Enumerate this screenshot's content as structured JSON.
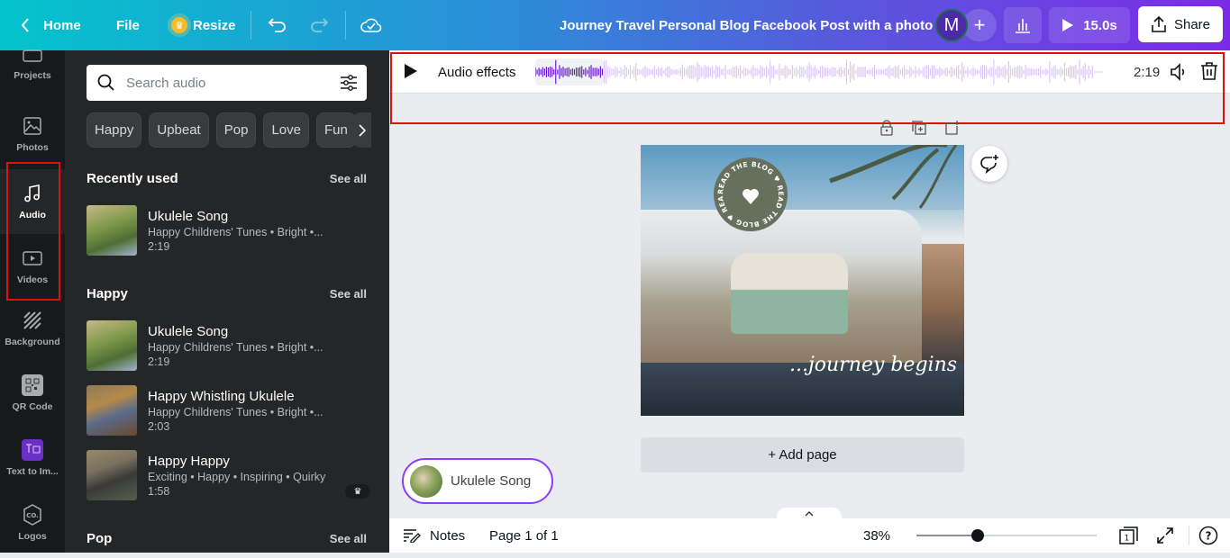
{
  "topbar": {
    "back_icon": "chevron-left-icon",
    "home": "Home",
    "file": "File",
    "resize": "Resize",
    "title": "Journey Travel Personal Blog Facebook Post with a photo",
    "avatar_initial": "M",
    "add_label": "+",
    "play_duration": "15.0s",
    "share": "Share",
    "colors": {
      "gradient_start": "#04c3cc",
      "gradient_end": "#7d2ae8"
    }
  },
  "rail": {
    "items": [
      {
        "label": "Projects",
        "icon": "folder-icon"
      },
      {
        "label": "Photos",
        "icon": "image-icon"
      },
      {
        "label": "Audio",
        "icon": "music-note-icon",
        "active": true
      },
      {
        "label": "Videos",
        "icon": "video-icon"
      },
      {
        "label": "Background",
        "icon": "stripes-icon"
      },
      {
        "label": "QR Code",
        "icon": "qr-code-icon"
      },
      {
        "label": "Text to Im...",
        "icon": "text-to-image-icon"
      },
      {
        "label": "Logos",
        "icon": "logo-hexagon-icon"
      }
    ]
  },
  "panel": {
    "search": {
      "placeholder": "Search audio",
      "value": ""
    },
    "chips": [
      "Happy",
      "Upbeat",
      "Pop",
      "Love",
      "Fun"
    ],
    "sections": [
      {
        "title": "Recently used",
        "see_all": "See all",
        "tracks": [
          {
            "name": "Ukulele Song",
            "meta": "Happy Childrens' Tunes • Bright •...",
            "duration": "2:19"
          }
        ]
      },
      {
        "title": "Happy",
        "see_all": "See all",
        "tracks": [
          {
            "name": "Ukulele Song",
            "meta": "Happy Childrens' Tunes • Bright •...",
            "duration": "2:19"
          },
          {
            "name": "Happy Whistling Ukulele",
            "meta": "Happy Childrens' Tunes • Bright •...",
            "duration": "2:03"
          },
          {
            "name": "Happy Happy",
            "meta": "Exciting • Happy • Inspiring • Quirky",
            "duration": "1:58",
            "pro": true
          }
        ]
      },
      {
        "title": "Pop",
        "see_all": "See all",
        "tracks": []
      }
    ]
  },
  "audio_bar": {
    "label": "Audio effects",
    "time": "2:19",
    "progress_fraction": 0.12
  },
  "canvas": {
    "badge_text": "READ THE BLOG ♥ READ THE BLOG ♥ READ THE BLOG ♥",
    "script_text": "...journey begins",
    "add_page": "+ Add page",
    "audio_chip": "Ukulele Song"
  },
  "bottom": {
    "notes": "Notes",
    "page_info": "Page 1 of 1",
    "zoom": "38%",
    "zoom_fraction": 0.34,
    "page_count": "1",
    "help": "?"
  }
}
